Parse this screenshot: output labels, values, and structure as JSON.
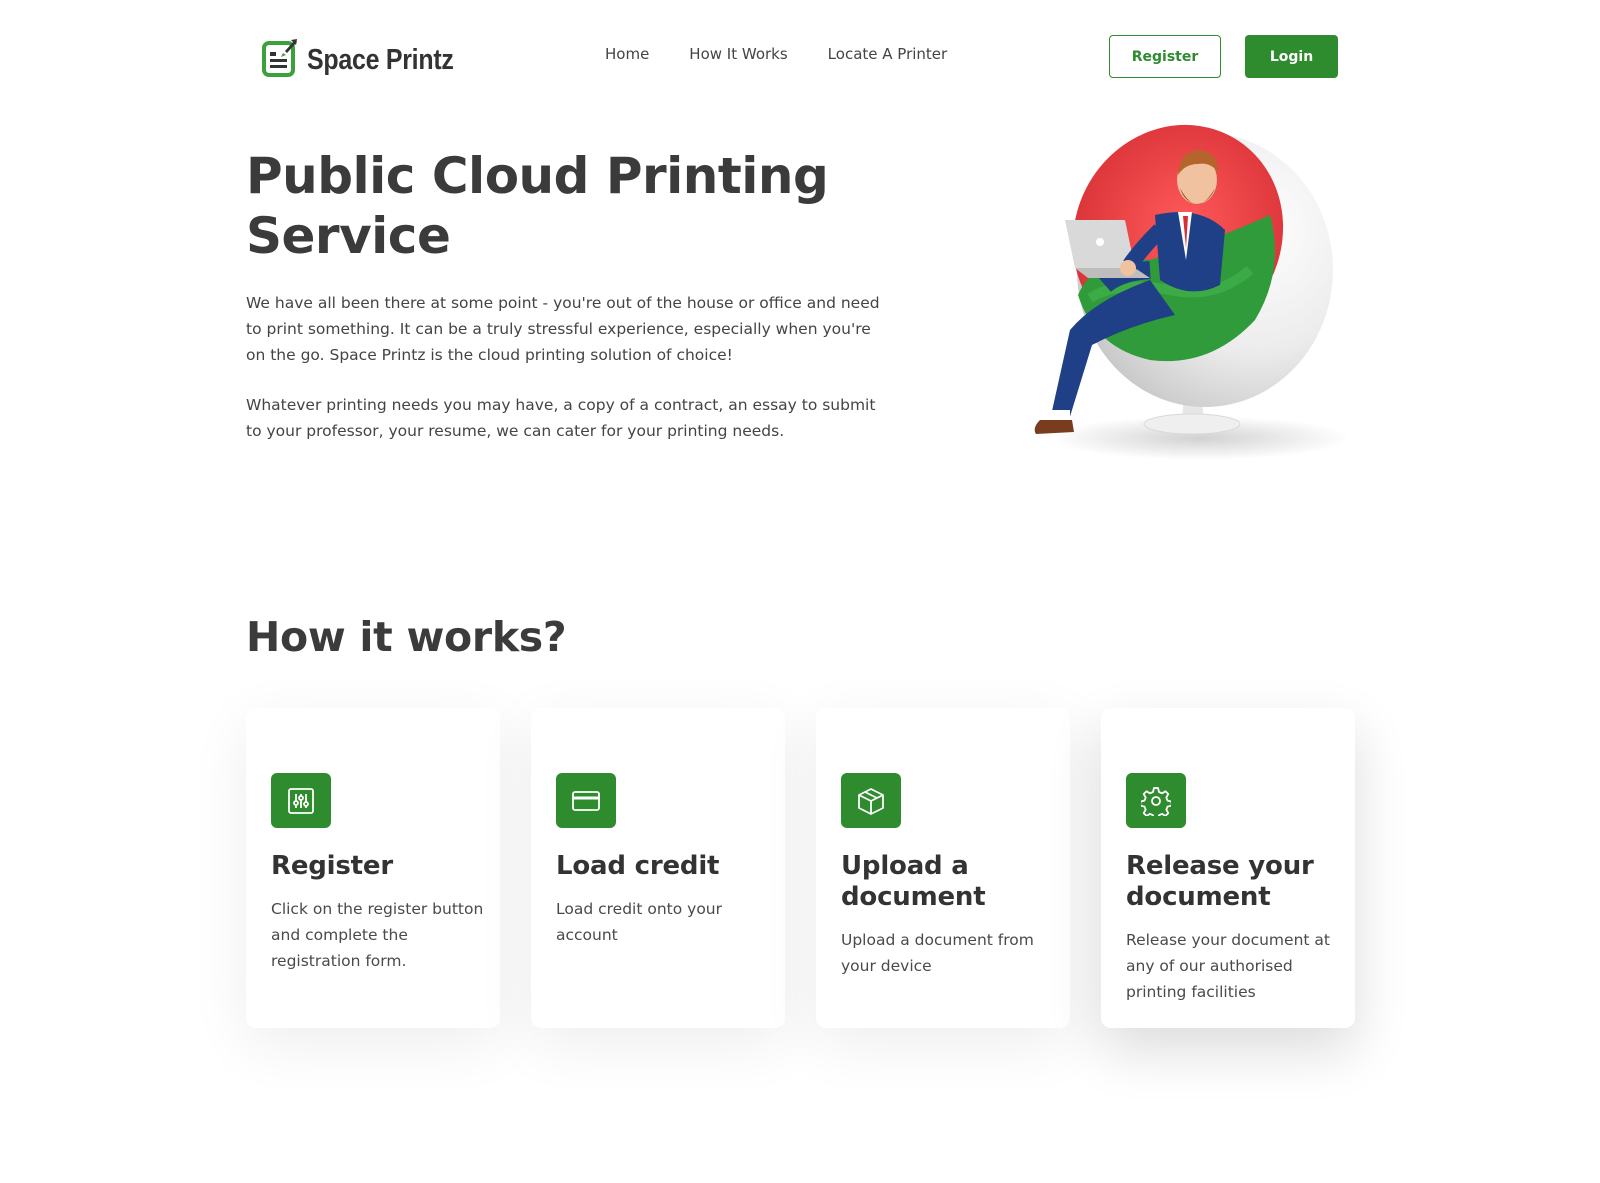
{
  "brand": {
    "name": "Space Printz",
    "primary_color": "#2e8b2e",
    "logo_icon": "document-rocket-icon"
  },
  "nav": {
    "items": [
      {
        "label": "Home"
      },
      {
        "label": "How It Works"
      },
      {
        "label": "Locate A Printer"
      }
    ],
    "register_label": "Register",
    "login_label": "Login"
  },
  "hero": {
    "title": "Public Cloud Printing Service",
    "paragraphs": [
      "We have all been there at some point - you're out of the house or office and need to print something. It can be a truly stressful experience, especially when you're on the go. Space Printz is the cloud printing solution of choice!",
      "Whatever printing needs you may have, a copy of a contract, an essay to submit to your professor, your resume, we can cater for your printing needs."
    ],
    "image": "man-in-egg-chair-with-laptop-illustration"
  },
  "how": {
    "title": "How it works?",
    "steps": [
      {
        "icon": "sliders-icon",
        "title": "Register",
        "desc": "Click on the register button and complete the registration form."
      },
      {
        "icon": "credit-card-icon",
        "title": "Load credit",
        "desc": "Load credit onto your account"
      },
      {
        "icon": "box-icon",
        "title": "Upload a document",
        "desc": "Upload a document from your device"
      },
      {
        "icon": "gear-icon",
        "title": "Release your document",
        "desc": "Release your document at any of our authorised printing facilities"
      }
    ]
  }
}
